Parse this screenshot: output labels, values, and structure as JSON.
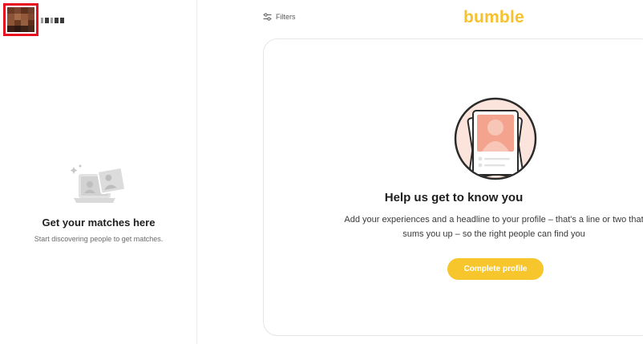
{
  "sidebar": {
    "empty_state": {
      "title": "Get your matches here",
      "subtitle": "Start discovering people to get matches."
    }
  },
  "header": {
    "filters_label": "Filters",
    "logo_text": "bumble"
  },
  "prompt_card": {
    "title": "Help us get to know you",
    "body": "Add your experiences and a headline to your profile – that's a line or two that sums you up – so the right people can find you",
    "cta_label": "Complete profile"
  },
  "colors": {
    "brand_yellow": "#f7c12b",
    "highlight_red": "#e8101f",
    "illustration_peach": "#f4b3a3"
  },
  "icons": [
    "filters-icon",
    "empty-matches-illustration",
    "profile-card-illustration"
  ]
}
